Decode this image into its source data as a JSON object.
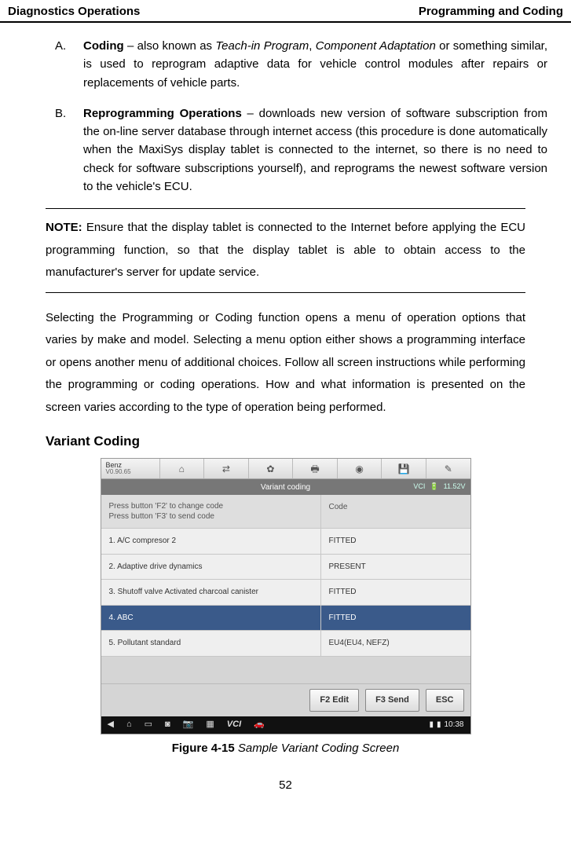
{
  "header": {
    "left": "Diagnostics Operations",
    "right": "Programming and Coding"
  },
  "list": {
    "a": {
      "marker": "A.",
      "title": "Coding",
      "dash": " – also known as ",
      "em1": "Teach-in Program",
      "comma": ", ",
      "em2": "Component Adaptation",
      "tail": " or something similar, is used to reprogram adaptive data for vehicle control modules after repairs or replacements of vehicle parts."
    },
    "b": {
      "marker": "B.",
      "title": "Reprogramming Operations",
      "tail": " – downloads new version of software subscription from the on-line server database through internet access (this procedure is done automatically when the MaxiSys display tablet is connected to the internet, so there is no need to check for software subscriptions yourself), and reprograms the newest software version to the vehicle's ECU."
    }
  },
  "note": {
    "label": "NOTE:",
    "text": " Ensure that the display tablet is connected to the Internet before applying the ECU programming function, so that the display tablet is able to obtain access to the manufacturer's server for update service."
  },
  "para1": "Selecting the Programming or Coding function opens a menu of operation options that varies by make and model. Selecting a menu option either shows a programming interface or opens another menu of additional choices. Follow all screen instructions while performing the programming or coding operations. How and what information is presented on the screen varies according to the type of operation being performed.",
  "section_heading": "Variant Coding",
  "screenshot": {
    "vehicle": {
      "name": "Benz",
      "version": "V0.90.65"
    },
    "titlebar": {
      "center": "Variant coding",
      "vci": "VCI",
      "batt": "11.52V"
    },
    "header_left_1": "Press button 'F2' to change code",
    "header_left_2": "Press button 'F3' to send code",
    "header_right": "Code",
    "rows": [
      {
        "label": "1. A/C compresor 2",
        "value": "FITTED"
      },
      {
        "label": "2. Adaptive drive dynamics",
        "value": "PRESENT"
      },
      {
        "label": "3. Shutoff valve Activated charcoal canister",
        "value": "FITTED"
      },
      {
        "label": "4. ABC",
        "value": "FITTED"
      },
      {
        "label": "5. Pollutant standard",
        "value": "EU4(EU4, NEFZ)"
      }
    ],
    "buttons": {
      "edit": "F2 Edit",
      "send": "F3 Send",
      "esc": "ESC"
    },
    "clock": "10:38"
  },
  "figure": {
    "num": "Figure 4-15",
    "title": " Sample Variant Coding Screen"
  },
  "page_number": "52"
}
